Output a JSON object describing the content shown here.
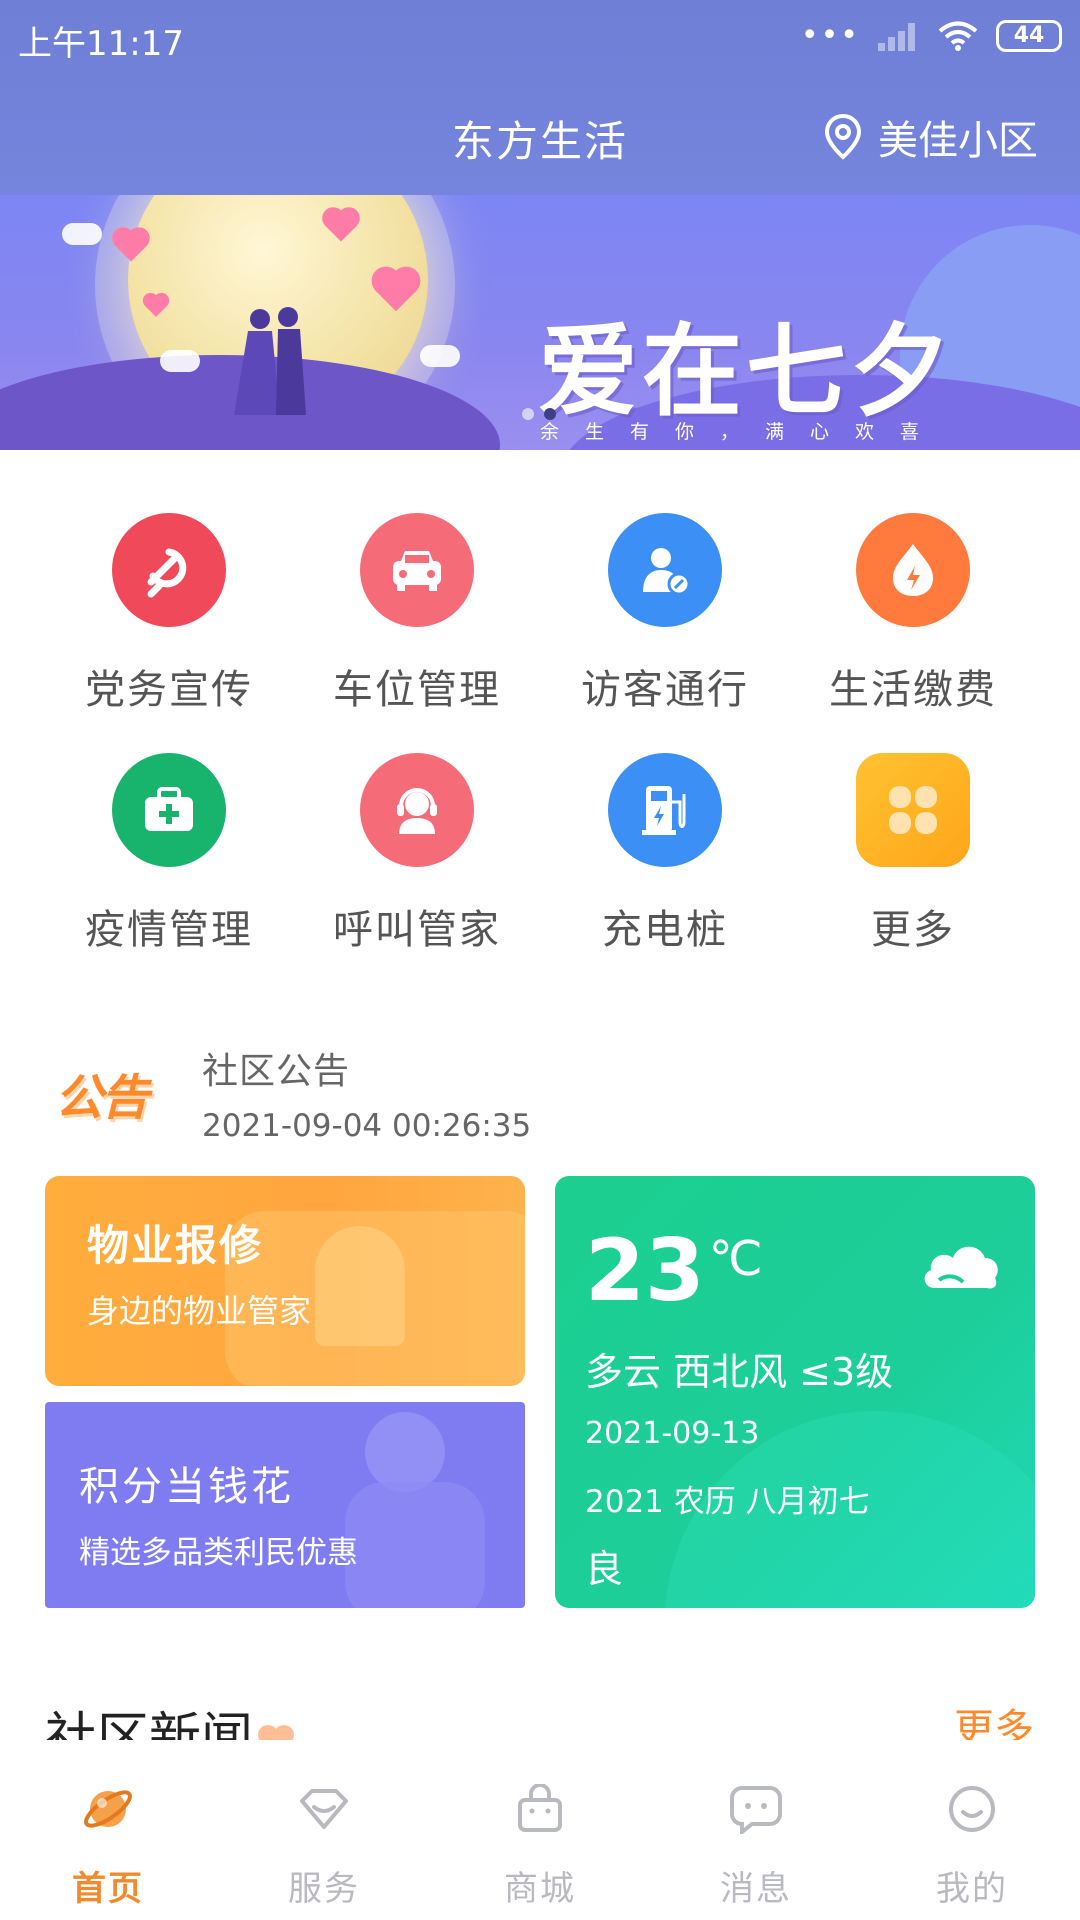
{
  "status": {
    "time": "上午11:17",
    "battery": "44"
  },
  "header": {
    "title": "东方生活",
    "location": "美佳小区"
  },
  "banner": {
    "title": "爱在七夕",
    "subtitle": "余生有你，满心欢喜"
  },
  "services": [
    {
      "label": "党务宣传",
      "color": "#f0495a",
      "icon": "party-emblem-icon"
    },
    {
      "label": "车位管理",
      "color": "#f56b78",
      "icon": "car-icon"
    },
    {
      "label": "访客通行",
      "color": "#3b8ff5",
      "icon": "visitor-icon"
    },
    {
      "label": "生活缴费",
      "color": "#ff7a3c",
      "icon": "flame-icon"
    },
    {
      "label": "疫情管理",
      "color": "#18b36d",
      "icon": "medical-kit-icon"
    },
    {
      "label": "呼叫管家",
      "color": "#f56b78",
      "icon": "headset-icon"
    },
    {
      "label": "充电桩",
      "color": "#3b8ff5",
      "icon": "charging-pile-icon"
    },
    {
      "label": "更多",
      "color": "#ffb020",
      "icon": "more-grid-icon"
    }
  ],
  "notice": {
    "logo": "公告",
    "title": "社区公告",
    "time": "2021-09-04 00:26:35"
  },
  "repair": {
    "title": "物业报修",
    "subtitle": "身边的物业管家"
  },
  "points": {
    "title": "积分当钱花",
    "subtitle": "精选多品类利民优惠"
  },
  "weather": {
    "temp": "23",
    "unit": "℃",
    "desc": "多云 西北风 ≤3级",
    "date": "2021-09-13",
    "lunar": "2021 农历 八月初七",
    "air": "良"
  },
  "news": {
    "title": "社区新闻",
    "more": "更多"
  },
  "nav": [
    {
      "label": "首页",
      "icon": "planet-icon",
      "active": true
    },
    {
      "label": "服务",
      "icon": "diamond-icon",
      "active": false
    },
    {
      "label": "商城",
      "icon": "shopping-bag-icon",
      "active": false
    },
    {
      "label": "消息",
      "icon": "chat-bubble-icon",
      "active": false
    },
    {
      "label": "我的",
      "icon": "smiley-icon",
      "active": false
    }
  ]
}
